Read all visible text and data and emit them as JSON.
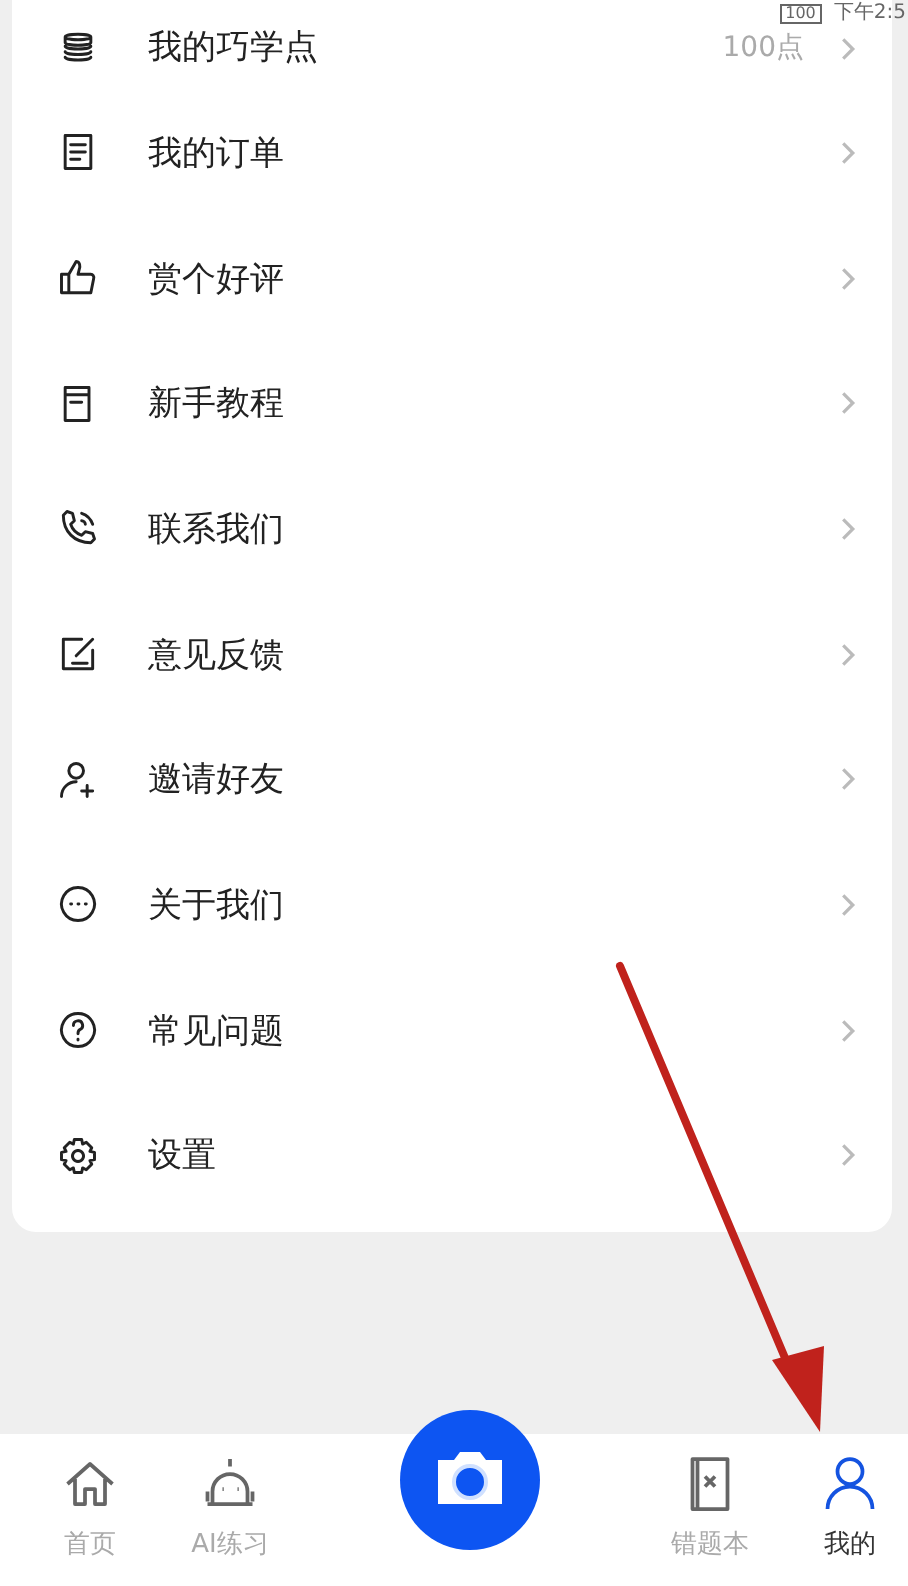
{
  "status_bar": {
    "battery": "100",
    "time": "下午2:5"
  },
  "menu": [
    {
      "label": "我的巧学点",
      "value": "100点"
    },
    {
      "label": "我的订单"
    },
    {
      "label": "赏个好评"
    },
    {
      "label": "新手教程"
    },
    {
      "label": "联系我们"
    },
    {
      "label": "意见反馈"
    },
    {
      "label": "邀请好友"
    },
    {
      "label": "关于我们"
    },
    {
      "label": "常见问题"
    },
    {
      "label": "设置"
    }
  ],
  "tab_bar": [
    {
      "kind": "tab",
      "label": "首页",
      "selected": false
    },
    {
      "kind": "tab",
      "label": "AI练习",
      "selected": false
    },
    {
      "kind": "camera",
      "selected": false
    },
    {
      "kind": "tab",
      "label": "错题本",
      "selected": false
    },
    {
      "kind": "tab",
      "label": "我的",
      "selected": true
    }
  ]
}
